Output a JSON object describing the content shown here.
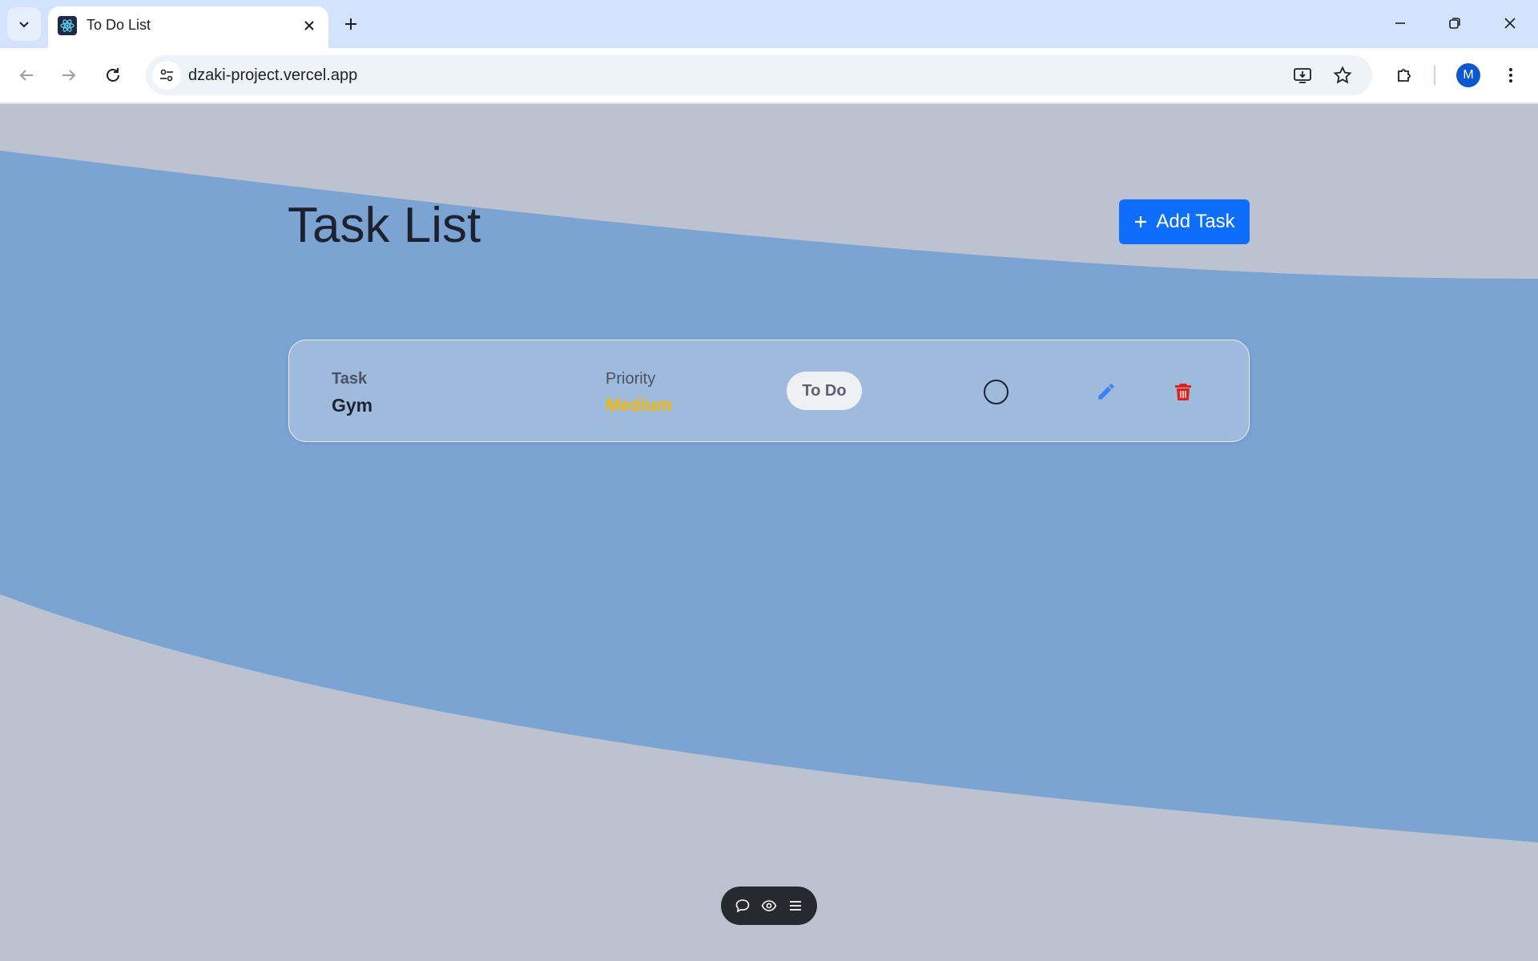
{
  "browser": {
    "tab": {
      "title": "To Do List",
      "favicon": "react-icon"
    },
    "address": {
      "url": "dzaki-project.vercel.app"
    },
    "profile_initial": "M"
  },
  "page": {
    "title": "Task List",
    "add_button": {
      "icon": "plus-icon",
      "label": "Add Task"
    },
    "tasks": [
      {
        "task_label": "Task",
        "task_name": "Gym",
        "priority_label": "Priority",
        "priority_value": "Medium",
        "status": "To Do",
        "completed": false
      }
    ]
  },
  "colors": {
    "accent": "#0d6efd",
    "priority_medium": "#f5b700",
    "delete": "#e0201b",
    "edit": "#3b82f6"
  },
  "floating_toolbar": [
    "comment-icon",
    "eye-icon",
    "menu-icon"
  ]
}
